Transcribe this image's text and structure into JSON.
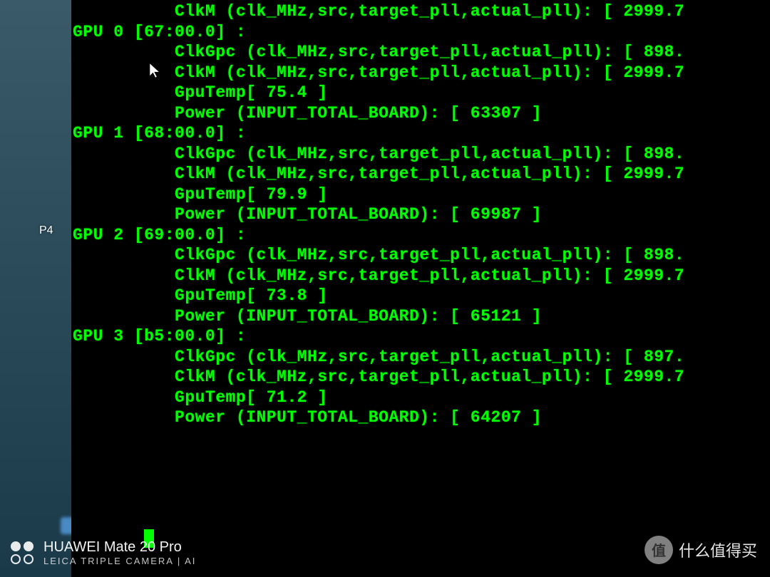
{
  "desktop": {
    "label": "P4"
  },
  "terminal": {
    "clk_header": "clk_MHz,src,target_pll,actual_pll",
    "power_label": "INPUT_TOTAL_BOARD",
    "top_clkm_value": "2999.7",
    "gpus": [
      {
        "index": "0",
        "bus_id": "67:00.0",
        "clkgpc_value": "898.",
        "clkm_value": "2999.7",
        "temp": "75.4",
        "power": "63307"
      },
      {
        "index": "1",
        "bus_id": "68:00.0",
        "clkgpc_value": "898.",
        "clkm_value": "2999.7",
        "temp": "79.9",
        "power": "69987"
      },
      {
        "index": "2",
        "bus_id": "69:00.0",
        "clkgpc_value": "898.",
        "clkm_value": "2999.7",
        "temp": "73.8",
        "power": "65121"
      },
      {
        "index": "3",
        "bus_id": "b5:00.0",
        "clkgpc_value": "897.",
        "clkm_value": "2999.7",
        "temp": "71.2",
        "power": "64207"
      }
    ]
  },
  "watermark": {
    "phone": "HUAWEI Mate 20 Pro",
    "camera": "LEICA TRIPLE CAMERA | AI",
    "badge_text": "值",
    "site": "什么值得买"
  }
}
